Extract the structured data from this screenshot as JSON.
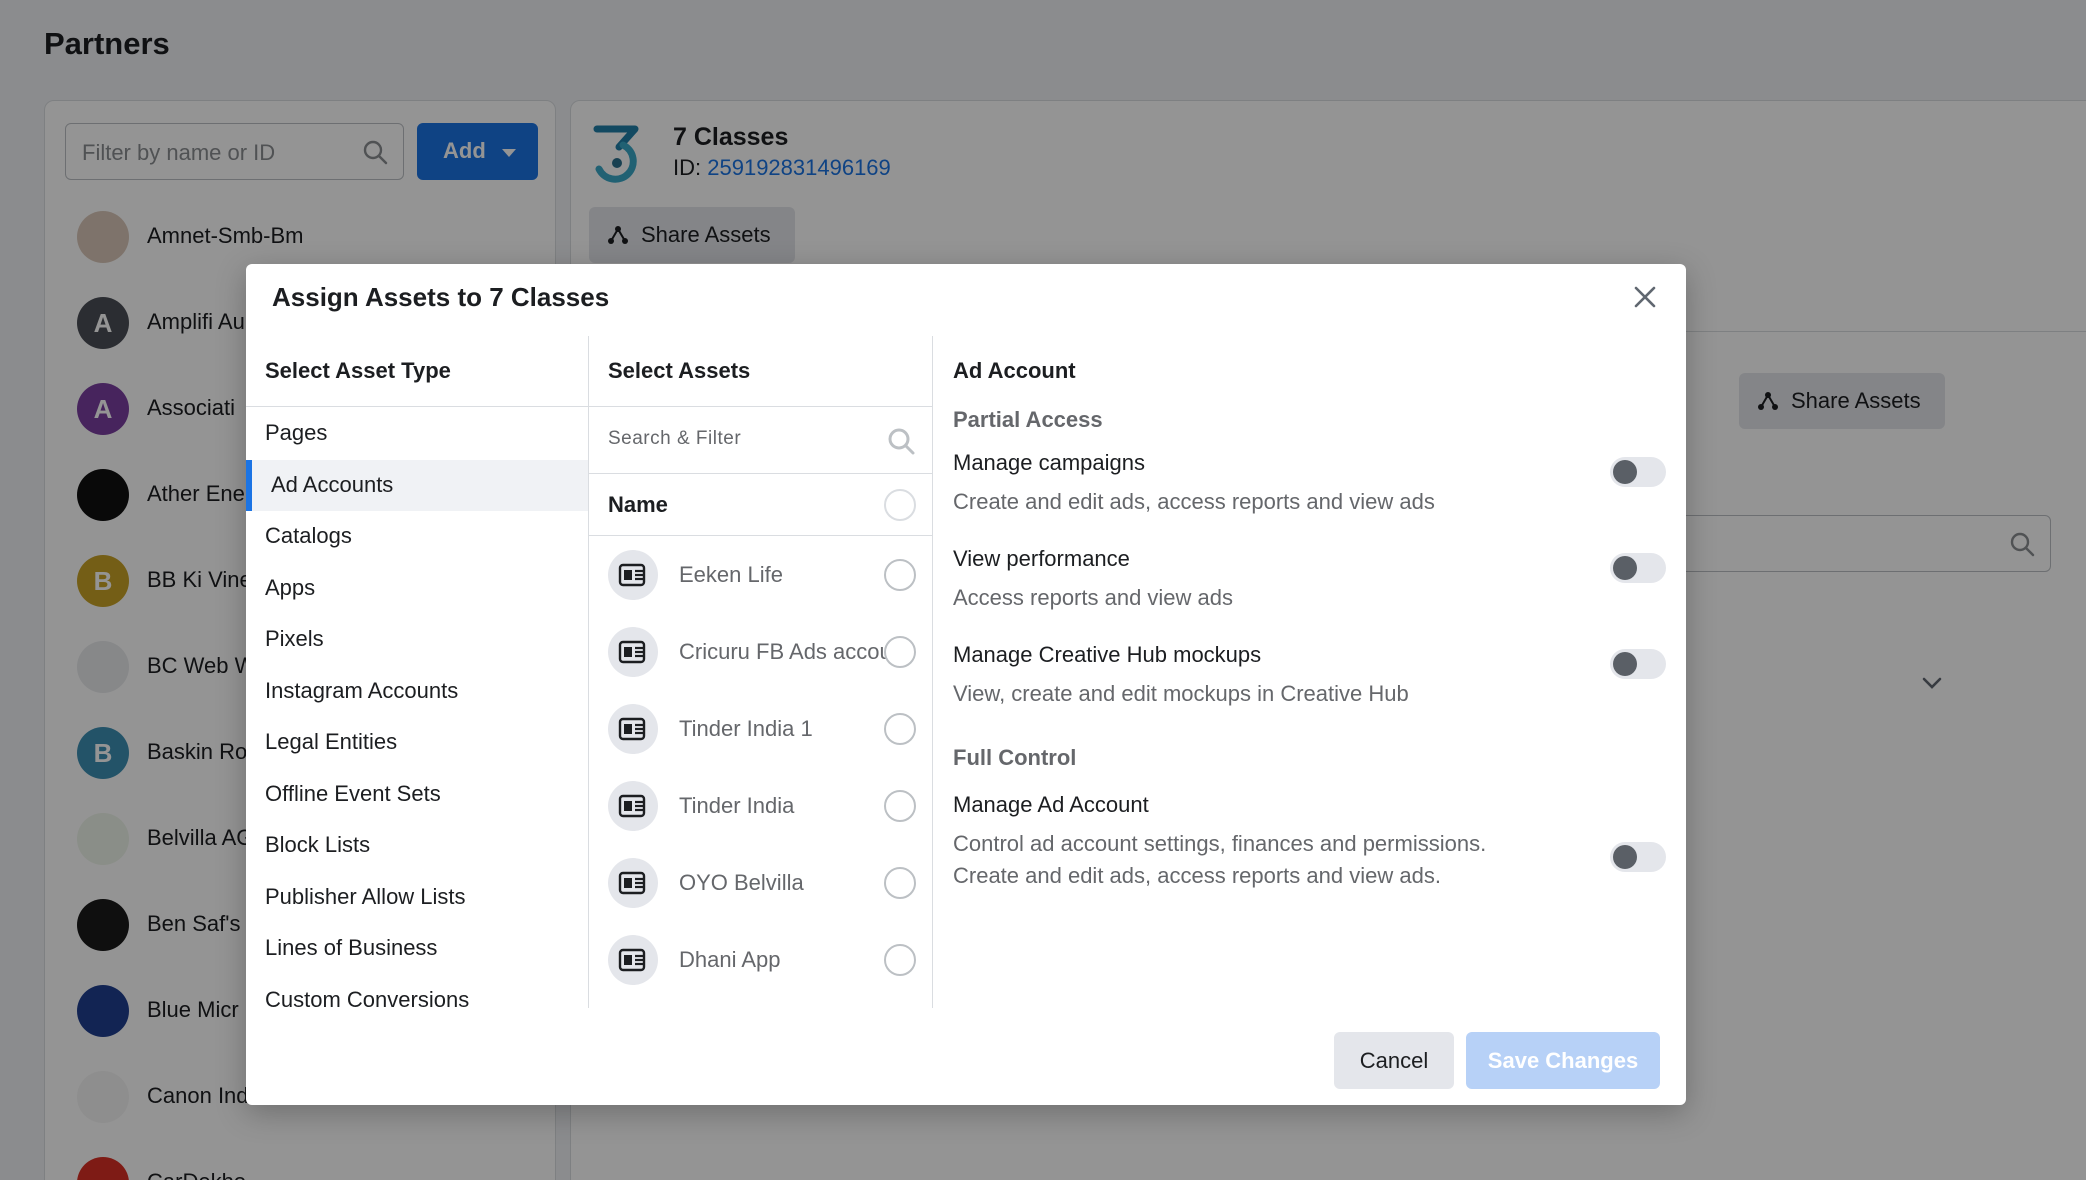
{
  "page": {
    "title": "Partners",
    "filter_placeholder": "Filter by name or ID",
    "add_label": "Add"
  },
  "partners": [
    {
      "name": "Amnet-Smb-Bm",
      "initial": "",
      "color": "#d9c7b8"
    },
    {
      "name": "Amplifi Au",
      "initial": "A",
      "color": "#4b4f56"
    },
    {
      "name": "Associati",
      "initial": "A",
      "color": "#7b3fa0"
    },
    {
      "name": "Ather Ener",
      "initial": "",
      "color": "#111111"
    },
    {
      "name": "BB Ki Vine",
      "initial": "B",
      "color": "#c9a227"
    },
    {
      "name": "BC Web W",
      "initial": "",
      "color": "#e8eaed"
    },
    {
      "name": "Baskin Ro",
      "initial": "B",
      "color": "#3d8fb3"
    },
    {
      "name": "Belvilla AG",
      "initial": "",
      "color": "#eef5ea"
    },
    {
      "name": "Ben Saf's",
      "initial": "",
      "color": "#1a1a1a"
    },
    {
      "name": "Blue Micr",
      "initial": "",
      "color": "#1f3f8f"
    },
    {
      "name": "Canon Ind",
      "initial": "",
      "color": "#f5f5f5"
    },
    {
      "name": "CarDekho",
      "initial": "",
      "color": "#d93025"
    }
  ],
  "detail": {
    "name": "7 Classes",
    "id_label": "ID:",
    "id_value": "259192831496169",
    "share_label": "Share Assets",
    "share_label_2": "Share Assets"
  },
  "modal": {
    "title": "Assign Assets to 7 Classes",
    "asset_type_header": "Select Asset Type",
    "asset_types": [
      {
        "label": "Pages",
        "active": false
      },
      {
        "label": "Ad Accounts",
        "active": true
      },
      {
        "label": "Catalogs",
        "active": false
      },
      {
        "label": "Apps",
        "active": false
      },
      {
        "label": "Pixels",
        "active": false
      },
      {
        "label": "Instagram Accounts",
        "active": false
      },
      {
        "label": "Legal Entities",
        "active": false
      },
      {
        "label": "Offline Event Sets",
        "active": false
      },
      {
        "label": "Block Lists",
        "active": false
      },
      {
        "label": "Publisher Allow Lists",
        "active": false
      },
      {
        "label": "Lines of Business",
        "active": false
      },
      {
        "label": "Custom Conversions",
        "active": false
      }
    ],
    "select_assets_header": "Select Assets",
    "search_placeholder": "Search & Filter",
    "name_header": "Name",
    "assets": [
      {
        "name": "Eeken Life"
      },
      {
        "name": "Cricuru FB Ads account"
      },
      {
        "name": "Tinder India 1"
      },
      {
        "name": "Tinder India"
      },
      {
        "name": "OYO Belvilla"
      },
      {
        "name": "Dhani App"
      }
    ],
    "permissions_header": "Ad Account",
    "partial_access_title": "Partial Access",
    "full_control_title": "Full Control",
    "permissions": [
      {
        "title": "Manage campaigns",
        "desc": "Create and edit ads, access reports and view ads",
        "enabled": false
      },
      {
        "title": "View performance",
        "desc": "Access reports and view ads",
        "enabled": false
      },
      {
        "title": "Manage Creative Hub mockups",
        "desc": "View, create and edit mockups in Creative Hub",
        "enabled": false
      },
      {
        "title": "Manage Ad Account",
        "desc": "Control ad account settings, finances and permissions. Create and edit ads, access reports and view ads.",
        "enabled": false
      }
    ],
    "cancel_label": "Cancel",
    "save_label": "Save Changes"
  },
  "colors": {
    "accent": "#1b74e4",
    "save_disabled": "#b7d1f7",
    "overlay": "rgba(0,0,0,0.42)"
  }
}
